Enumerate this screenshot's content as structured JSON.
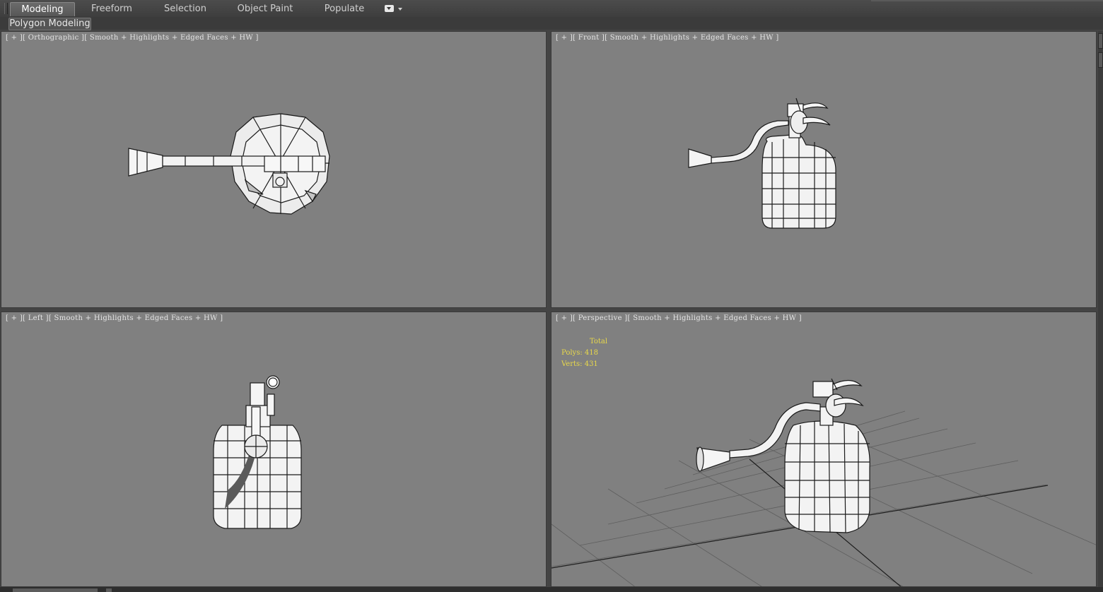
{
  "ribbon": {
    "tabs": [
      {
        "label": "Modeling",
        "active": true
      },
      {
        "label": "Freeform",
        "active": false
      },
      {
        "label": "Selection",
        "active": false
      },
      {
        "label": "Object Paint",
        "active": false
      },
      {
        "label": "Populate",
        "active": false
      }
    ],
    "options_icon": "ribbon-options-icon"
  },
  "subbar": {
    "panel_label": "Polygon Modeling"
  },
  "viewports": {
    "top_left": {
      "label": "[ + ][ Orthographic ][ Smooth + Highlights + Edged Faces + HW ]"
    },
    "top_right": {
      "label": "[ + ][ Front ][ Smooth + Highlights + Edged Faces + HW ]"
    },
    "bottom_left": {
      "label": "[ + ][ Left ][ Smooth + Highlights + Edged Faces + HW ]"
    },
    "bottom_right": {
      "label": "[ + ][ Perspective ][ Smooth + Highlights + Edged Faces + HW ]"
    }
  },
  "stats": {
    "total": "Total",
    "polys": "Polys: 418",
    "verts": "Verts: 431"
  },
  "colors": {
    "viewport_bg": "#808080",
    "ui_bg": "#444444",
    "stats_text": "#e8d84a",
    "label_text": "#e4e4e4"
  }
}
